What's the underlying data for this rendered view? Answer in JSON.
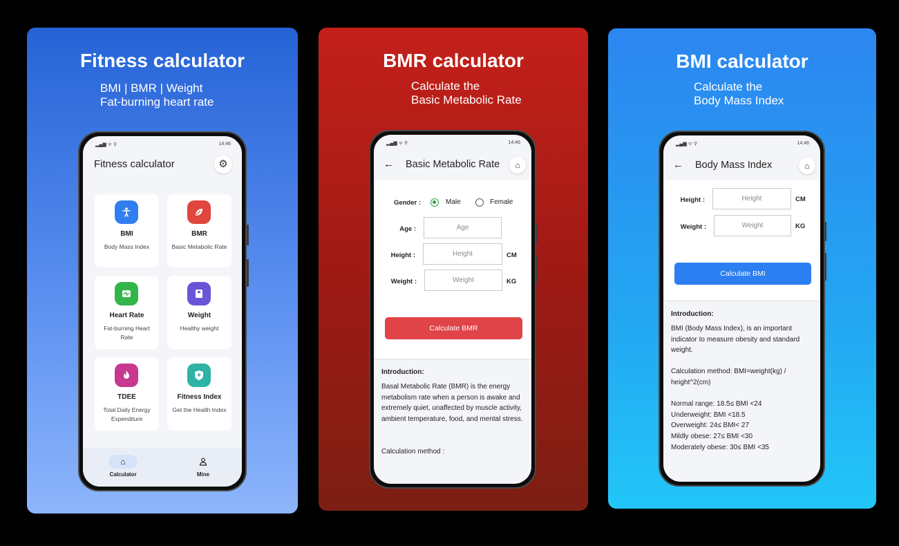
{
  "panels": {
    "fitness": {
      "title": "Fitness calculator",
      "subtitle": "BMI | BMR | Weight\nFat-burning heart rate",
      "phone": {
        "time": "14:46",
        "app_title": "Fitness calculator",
        "settings_icon": "gear-icon",
        "cards": [
          {
            "name": "BMI",
            "desc": "Body Mass Index",
            "icon": "person-icon",
            "color": "#2f7ff0"
          },
          {
            "name": "BMR",
            "desc": "Basic Metabolic Rate",
            "icon": "leaf-icon",
            "color": "#e0453e"
          },
          {
            "name": "Heart Rate",
            "desc": "Fat-burning Heart Rate",
            "icon": "pulse-icon",
            "color": "#33b54a"
          },
          {
            "name": "Weight",
            "desc": "Healthy weight",
            "icon": "scale-icon",
            "color": "#6a55d6"
          },
          {
            "name": "TDEE",
            "desc": "Total Daily Energy Expenditure",
            "icon": "flame-icon",
            "color": "#c7388f"
          },
          {
            "name": "Fitness Index",
            "desc": "Get the Health Index",
            "icon": "shield-icon",
            "color": "#2fb3a7"
          }
        ],
        "nav": [
          {
            "label": "Calculator",
            "icon": "home-icon",
            "active": true
          },
          {
            "label": "Mine",
            "icon": "user-icon",
            "active": false
          }
        ]
      }
    },
    "bmr": {
      "title": "BMR calculator",
      "subtitle": "Calculate the\nBasic Metabolic Rate",
      "phone": {
        "time": "14:46",
        "screen_title": "Basic Metabolic Rate",
        "gender_label": "Gender :",
        "gender_options": [
          "Male",
          "Female"
        ],
        "gender_selected": "Male",
        "age_label": "Age :",
        "age_placeholder": "Age",
        "height_label": "Height :",
        "height_placeholder": "Height",
        "height_unit": "CM",
        "weight_label": "Weight :",
        "weight_placeholder": "Weight",
        "weight_unit": "KG",
        "button": "Calculate BMR",
        "button_color": "#e04448",
        "intro_heading": "Introduction:",
        "intro_text": "Basal Metabolic Rate (BMR) is the energy metabolism rate when a person is awake and extremely quiet, unaffected by muscle activity, ambient temperature, food, and mental stress.",
        "method_text": "Calculation method :"
      }
    },
    "bmi": {
      "title": "BMI calculator",
      "subtitle": "Calculate the\nBody Mass Index",
      "phone": {
        "time": "14:46",
        "screen_title": "Body Mass Index",
        "height_label": "Height :",
        "height_placeholder": "Height",
        "height_unit": "CM",
        "weight_label": "Weight :",
        "weight_placeholder": "Weight",
        "weight_unit": "KG",
        "button": "Calculate BMI",
        "button_color": "#2b7ff0",
        "intro_heading": "Introduction:",
        "intro_text": "BMI (Body Mass Index), is an important indicator to measure obesity and standard weight.\n\nCalculation method: BMI=weight(kg) / height^2(cm)\n\nNormal range:  18.5≤ BMI <24\nUnderweight:  BMI <18.5\nOverweight:  24≤ BMI< 27\nMildly obese:  27≤ BMI <30\nModerately obese:  30≤ BMI <35"
      }
    }
  }
}
